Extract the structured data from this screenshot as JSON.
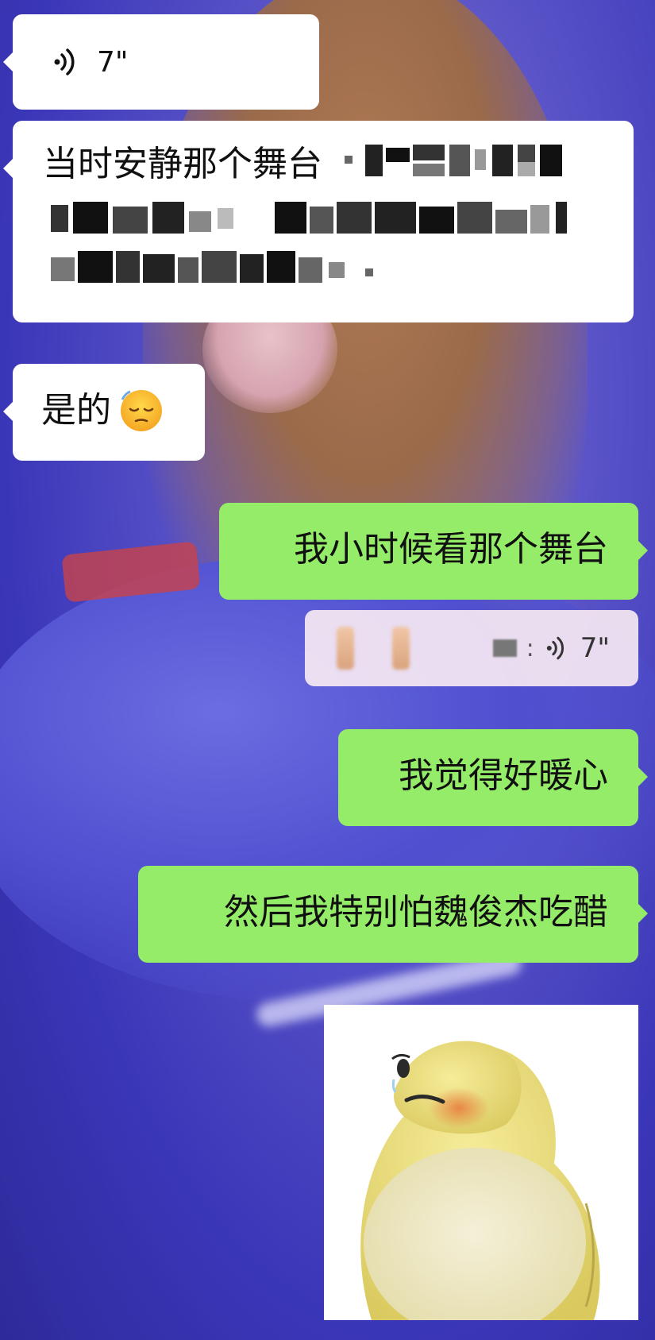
{
  "messages": {
    "voice1": {
      "duration": "7\""
    },
    "text1": {
      "text": "当时安静那个舞台"
    },
    "text2": {
      "text": "是的"
    },
    "text3": {
      "text": "我小时候看那个舞台"
    },
    "quoted_voice": {
      "duration": "7\""
    },
    "text4": {
      "text": "我觉得好暖心"
    },
    "text5": {
      "text": "然后我特别怕魏俊杰吃醋"
    }
  },
  "icons": {
    "voice_wave": "voice-wave-icon",
    "emoji": "pensive-face-emoji",
    "sticker": "sad-penguin-sticker"
  },
  "colors": {
    "incoming_bubble": "#ffffff",
    "outgoing_bubble": "#95ec69",
    "background": "#3a36b8"
  }
}
